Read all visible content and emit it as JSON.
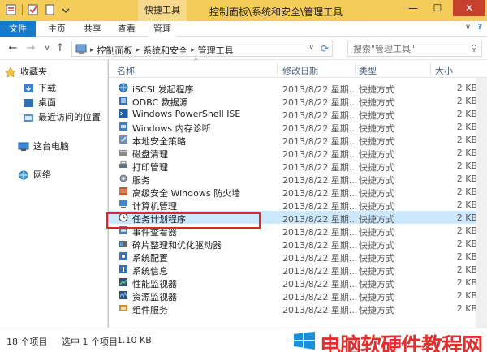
{
  "window": {
    "context_tab_label": "快捷工具",
    "title": "控制面板\\系统和安全\\管理工具",
    "minimize": "—",
    "maximize": "☐",
    "close": "✕"
  },
  "ribbon": {
    "tabs": [
      "文件",
      "主页",
      "共享",
      "查看",
      "管理"
    ],
    "expand_glyph": "∨",
    "help_glyph": "?"
  },
  "address": {
    "crumbs": [
      "控制面板",
      "系统和安全",
      "管理工具"
    ],
    "search_placeholder": "搜索\"管理工具\""
  },
  "nav": {
    "favorites": "收藏夹",
    "downloads": "下载",
    "desktop": "桌面",
    "recent": "最近访问的位置",
    "this_pc": "这台电脑",
    "network": "网络"
  },
  "columns": {
    "name": "名称",
    "date": "修改日期",
    "type": "类型",
    "size": "大小"
  },
  "files": [
    {
      "name": "iSCSI 发起程序",
      "date": "2013/8/22 星期...",
      "type": "快捷方式",
      "size": "2 KB",
      "icon": "globe-icon"
    },
    {
      "name": "ODBC 数据源",
      "date": "2013/8/22 星期...",
      "type": "快捷方式",
      "size": "2 KB",
      "icon": "database-icon"
    },
    {
      "name": "Windows PowerShell ISE",
      "date": "2013/8/22 星期...",
      "type": "快捷方式",
      "size": "2 KB",
      "icon": "powershell-icon"
    },
    {
      "name": "Windows 内存诊断",
      "date": "2013/8/22 星期...",
      "type": "快捷方式",
      "size": "2 KB",
      "icon": "memory-icon"
    },
    {
      "name": "本地安全策略",
      "date": "2013/8/22 星期...",
      "type": "快捷方式",
      "size": "2 KB",
      "icon": "security-policy-icon"
    },
    {
      "name": "磁盘清理",
      "date": "2013/8/22 星期...",
      "type": "快捷方式",
      "size": "2 KB",
      "icon": "disk-cleanup-icon"
    },
    {
      "name": "打印管理",
      "date": "2013/8/22 星期...",
      "type": "快捷方式",
      "size": "2 KB",
      "icon": "printer-icon"
    },
    {
      "name": "服务",
      "date": "2013/8/22 星期...",
      "type": "快捷方式",
      "size": "2 KB",
      "icon": "services-icon"
    },
    {
      "name": "高级安全 Windows 防火墙",
      "date": "2013/8/22 星期...",
      "type": "快捷方式",
      "size": "2 KB",
      "icon": "firewall-icon"
    },
    {
      "name": "计算机管理",
      "date": "2013/8/22 星期...",
      "type": "快捷方式",
      "size": "2 KB",
      "icon": "computer-management-icon"
    },
    {
      "name": "任务计划程序",
      "date": "2013/8/22 星期...",
      "type": "快捷方式",
      "size": "2 KB",
      "icon": "clock-icon",
      "selected": true
    },
    {
      "name": "事件查看器",
      "date": "2013/8/22 星期...",
      "type": "快捷方式",
      "size": "2 KB",
      "icon": "event-viewer-icon"
    },
    {
      "name": "碎片整理和优化驱动器",
      "date": "2013/8/22 星期...",
      "type": "快捷方式",
      "size": "2 KB",
      "icon": "defrag-icon"
    },
    {
      "name": "系统配置",
      "date": "2013/8/22 星期...",
      "type": "快捷方式",
      "size": "2 KB",
      "icon": "system-config-icon"
    },
    {
      "name": "系统信息",
      "date": "2013/8/22 星期...",
      "type": "快捷方式",
      "size": "2 KB",
      "icon": "system-info-icon"
    },
    {
      "name": "性能监视器",
      "date": "2013/8/22 星期...",
      "type": "快捷方式",
      "size": "2 KB",
      "icon": "performance-icon"
    },
    {
      "name": "资源监视器",
      "date": "2013/8/22 星期...",
      "type": "快捷方式",
      "size": "2 KB",
      "icon": "resource-monitor-icon"
    },
    {
      "name": "组件服务",
      "date": "2013/8/22 星期...",
      "type": "快捷方式",
      "size": "2 KB",
      "icon": "component-services-icon"
    }
  ],
  "status": {
    "item_count": "18 个项目",
    "selection": "选中 1 个项目",
    "selection_size": "1.10 KB",
    "watermark": "电脑软硬件教程网"
  },
  "colors": {
    "titlebar": "#f3cc59",
    "file_tab": "#1979ca",
    "selected_row": "#cce8ff",
    "highlight_border": "#e0252b"
  }
}
